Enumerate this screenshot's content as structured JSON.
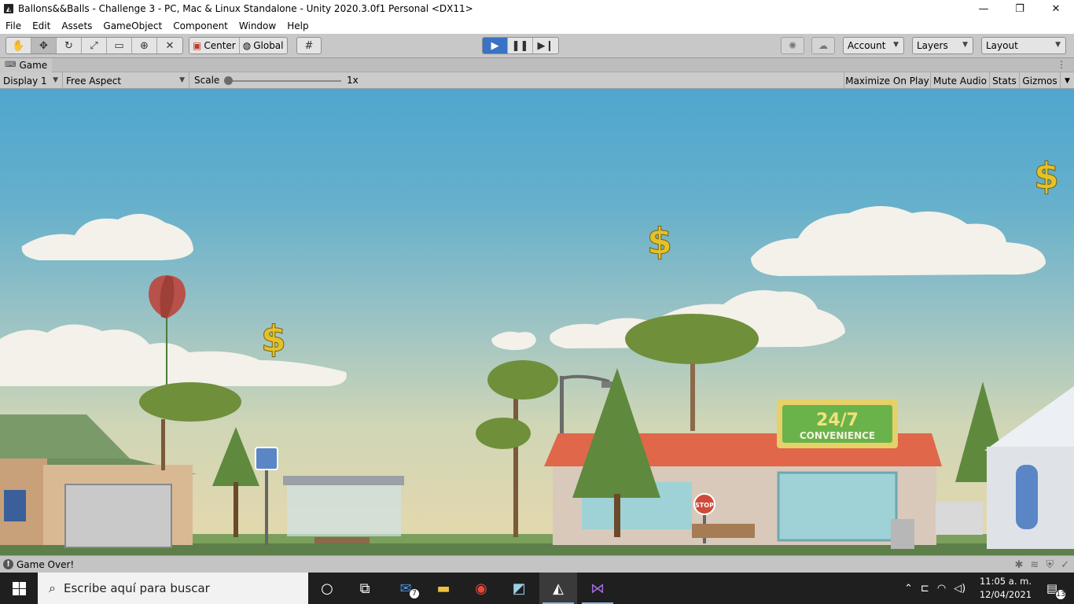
{
  "window": {
    "title": "Ballons&&Balls - Challenge 3 - PC, Mac & Linux Standalone - Unity 2020.3.0f1 Personal <DX11>",
    "minimize": "—",
    "maximize": "❐",
    "close": "✕"
  },
  "menu": [
    "File",
    "Edit",
    "Assets",
    "GameObject",
    "Component",
    "Window",
    "Help"
  ],
  "toolbar": {
    "pivot_label": "Center",
    "space_label": "Global",
    "account_label": "Account",
    "layers_label": "Layers",
    "layout_label": "Layout",
    "play_state": "playing"
  },
  "game_tab": {
    "label": "Game"
  },
  "game_view": {
    "display": "Display 1",
    "aspect": "Free Aspect",
    "scale_label": "Scale",
    "scale_value": "1x",
    "maximize_on_play": "Maximize On Play",
    "mute_audio": "Mute Audio",
    "stats": "Stats",
    "gizmos": "Gizmos"
  },
  "scene": {
    "store_sign_number": "24/7",
    "store_sign_text": "CONVENIENCE",
    "stop_sign": "STOP",
    "coin_symbol": "$"
  },
  "status": {
    "message": "Game Over!"
  },
  "taskbar": {
    "search_placeholder": "Escribe aquí para buscar",
    "mail_badge": "7",
    "time": "11:05 a. m.",
    "date": "12/04/2021",
    "notifications": "13"
  },
  "colors": {
    "play_blue": "#3a72c4",
    "sky_top": "#4fa6cf",
    "sky_bottom": "#e7d8ac",
    "balloon": "#b8514a",
    "coin": "#e3c12a",
    "roof": "#e0674a",
    "sign_green": "#6ab34a"
  }
}
